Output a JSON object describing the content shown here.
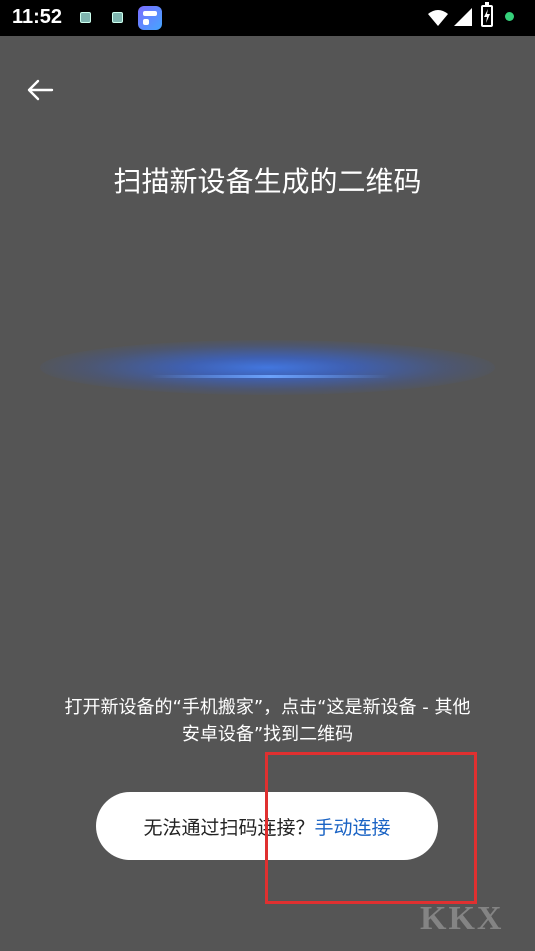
{
  "status_bar": {
    "time": "11:52",
    "icons": [
      "notification-icon",
      "notification-icon",
      "app-icon",
      "wifi-icon",
      "signal-icon",
      "battery-charging-icon",
      "status-dot-icon"
    ],
    "dot_color": "#35d07a"
  },
  "header": {
    "back_icon": "arrow-left-icon",
    "title": "扫描新设备生成的二维码"
  },
  "scanner": {
    "glow_color": "#4178e6"
  },
  "instruction": {
    "line1": "打开新设备的“手机搬家”，点击“这是新设备 - 其他",
    "line2": "安卓设备”找到二维码"
  },
  "bottom_action": {
    "prefix": "无法通过扫码连接？",
    "link": "手动连接",
    "link_color": "#1a63c4"
  },
  "colors": {
    "background": "#555555",
    "highlight": "#e03030"
  }
}
